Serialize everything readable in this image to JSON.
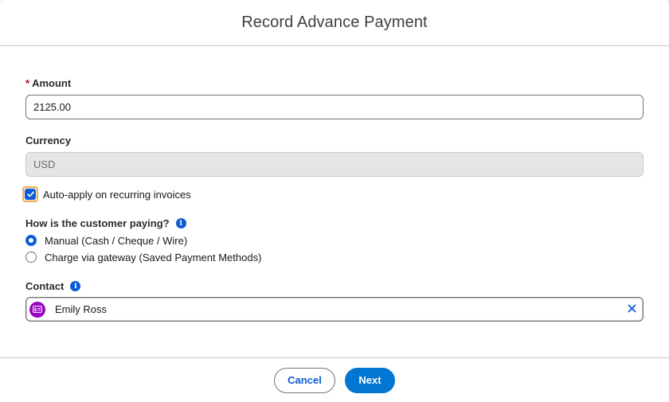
{
  "modal": {
    "title": "Record Advance Payment"
  },
  "amount": {
    "required_marker": "*",
    "label": "Amount",
    "value": "2125.00"
  },
  "currency": {
    "label": "Currency",
    "value": "USD"
  },
  "auto_apply": {
    "label": "Auto-apply on recurring invoices",
    "checked": true
  },
  "payment_method": {
    "label": "How is the customer paying?",
    "options": [
      {
        "label": "Manual (Cash / Cheque / Wire)",
        "selected": true
      },
      {
        "label": "Charge via gateway (Saved Payment Methods)",
        "selected": false
      }
    ]
  },
  "contact": {
    "label": "Contact",
    "value": "Emily Ross",
    "icon": "contact-card-icon"
  },
  "footer": {
    "cancel_label": "Cancel",
    "next_label": "Next"
  },
  "colors": {
    "brand": "#0176d3",
    "link": "#0b5cd5",
    "required": "#ba0517",
    "contact_avatar": "#9603c2",
    "focus_ring": "#f0a95a"
  }
}
